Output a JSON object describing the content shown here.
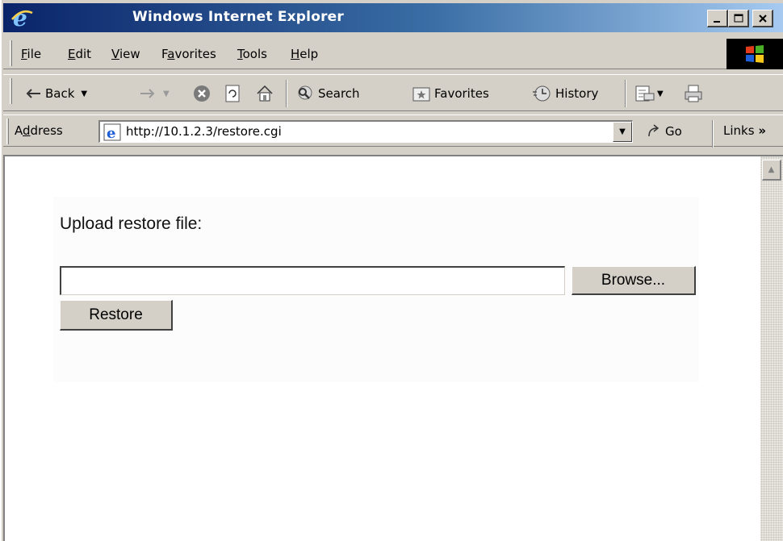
{
  "window": {
    "title": "Windows Internet Explorer",
    "controls": {
      "minimize": "_",
      "maximize": "□",
      "close": "×"
    }
  },
  "menu": {
    "items": [
      {
        "label": "File",
        "accel": "F",
        "rest": "ile"
      },
      {
        "label": "Edit",
        "accel": "E",
        "rest": "dit"
      },
      {
        "label": "View",
        "accel": "V",
        "rest": "iew"
      },
      {
        "label": "Favorites",
        "pre": "F",
        "accel": "a",
        "rest": "vorites"
      },
      {
        "label": "Tools",
        "accel": "T",
        "rest": "ools"
      },
      {
        "label": "Help",
        "accel": "H",
        "rest": "elp"
      }
    ]
  },
  "toolbar": {
    "back": "Back",
    "search": "Search",
    "favorites": "Favorites",
    "history": "History"
  },
  "address": {
    "label_pre": "A",
    "label_accel": "d",
    "label_rest": "dress",
    "url": "http://10.1.2.3/restore.cgi",
    "go": "Go",
    "links": "Links",
    "links_more": "»"
  },
  "page": {
    "upload_label": "Upload restore file:",
    "file_value": "",
    "browse_label": "Browse...",
    "restore_label": "Restore"
  },
  "colors": {
    "chrome": "#d4d0c8",
    "titlebar_start": "#0a246a",
    "titlebar_end": "#a6caf0"
  }
}
